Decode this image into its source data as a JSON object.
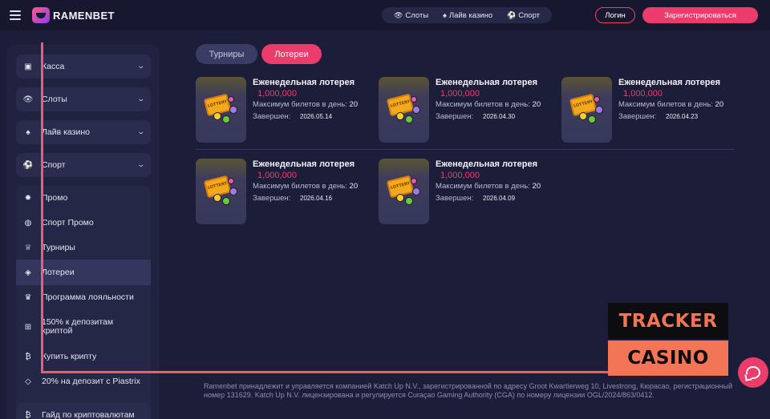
{
  "header": {
    "logo_text": "RAMENBET",
    "nav": [
      {
        "label": "Слоты",
        "icon": "slots-icon"
      },
      {
        "label": "Лайв казино",
        "icon": "live-casino-icon"
      },
      {
        "label": "Спорт",
        "icon": "sport-icon"
      }
    ],
    "login_label": "Логин",
    "register_label": "Зарегистрироваться"
  },
  "sidebar": {
    "groups": [
      {
        "label": "Касса",
        "icon": "wallet-icon"
      },
      {
        "label": "Слоты",
        "icon": "slots-icon"
      },
      {
        "label": "Лайв казино",
        "icon": "live-casino-icon"
      },
      {
        "label": "Спорт",
        "icon": "sport-icon"
      }
    ],
    "items": [
      {
        "label": "Промо",
        "icon": "promo-icon"
      },
      {
        "label": "Спорт Промо",
        "icon": "sport-promo-icon"
      },
      {
        "label": "Турниры",
        "icon": "trophy-icon"
      },
      {
        "label": "Лотереи",
        "icon": "ticket-icon"
      },
      {
        "label": "Программа лояльности",
        "icon": "crown-icon"
      },
      {
        "label": "150% к депозитам",
        "label2": "криптой",
        "icon": "gift-icon"
      },
      {
        "label": "Купить крипту",
        "icon": "bitcoin-icon"
      },
      {
        "label": "20% на депозит с Piastrix",
        "icon": "piastrix-icon"
      }
    ],
    "last_item": {
      "label": "Гайд по криптовалютам",
      "icon": "bitcoin-icon"
    }
  },
  "tabs": {
    "tournaments": "Турниры",
    "lotteries": "Лотереи"
  },
  "lottery_cards": [
    {
      "title": "Еженедельная лотерея",
      "prize": "1,000,000",
      "max_label": "Максимум билетов в день:",
      "max_value": "20",
      "end_label": "Завершен:",
      "end_date": "2026.05.14",
      "thumb_text": "LOTTERY"
    },
    {
      "title": "Еженедельная лотерея",
      "prize": "1,000,000",
      "max_label": "Максимум билетов в день:",
      "max_value": "20",
      "end_label": "Завершен:",
      "end_date": "2026.04.30",
      "thumb_text": "LOTTERY"
    },
    {
      "title": "Еженедельная лотерея",
      "prize": "1,000,000",
      "max_label": "Максимум билетов в день:",
      "max_value": "20",
      "end_label": "Завершен:",
      "end_date": "2026.04.23",
      "thumb_text": "LOTTERY"
    },
    {
      "title": "Еженедельная лотерея",
      "prize": "1,000,000",
      "max_label": "Максимум билетов в день:",
      "max_value": "20",
      "end_label": "Завершен:",
      "end_date": "2026.04.16",
      "thumb_text": "LOTTERY"
    },
    {
      "title": "Еженедельная лотерея",
      "prize": "1,000,000",
      "max_label": "Максимум билетов в день:",
      "max_value": "20",
      "end_label": "Завершен:",
      "end_date": "2026.04.09",
      "thumb_text": "LOTTERY"
    }
  ],
  "footer": {
    "legal": "Ramenbet принадлежит и управляется компанией Katch Up N.V., зарегистрированной по адресу Groot Kwartierweg 10, Livestrong, Кюрасао, регистрационный номер 131629. Katch Up N.V. лицензирована и регулируется Curaçao Gaming Authority (CGA) по номеру лицензии OGL/2024/863/0412."
  },
  "overlay": {
    "tracker": "TRACKER",
    "casino": "CASINO"
  },
  "colors": {
    "background": "#1c1d39",
    "accent": "#ea3d6b",
    "overlay_orange": "#f27558"
  }
}
